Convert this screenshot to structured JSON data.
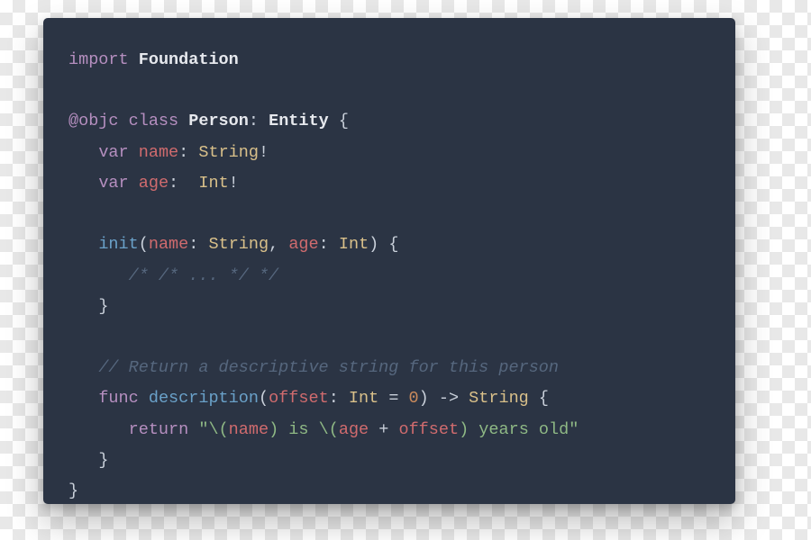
{
  "code": {
    "l1": {
      "import": "import",
      "module": "Foundation"
    },
    "l3": {
      "objc": "@objc",
      "class_kw": "class",
      "person": "Person",
      "entity": "Entity"
    },
    "l4": {
      "var_kw": "var",
      "name": "name",
      "string_ty": "String"
    },
    "l5": {
      "var_kw": "var",
      "age": "age",
      "int_ty": "Int"
    },
    "l7": {
      "init": "init",
      "name_p": "name",
      "string_ty": "String",
      "age_p": "age",
      "int_ty": "Int"
    },
    "l8": {
      "comment": "/* /* ... */ */"
    },
    "l11": {
      "comment": "// Return a descriptive string for this person"
    },
    "l12": {
      "func_kw": "func",
      "desc": "description",
      "offset": "offset",
      "int_ty": "Int",
      "zero": "0",
      "string_ty": "String"
    },
    "l13": {
      "return_kw": "return",
      "s1": "\"\\(",
      "name": "name",
      "s2": ")",
      "is": " is ",
      "s3": "\\(",
      "age": "age",
      "plus": " + ",
      "offset": "offset",
      "s4": ")",
      "tail": " years old",
      "s5": "\""
    }
  }
}
